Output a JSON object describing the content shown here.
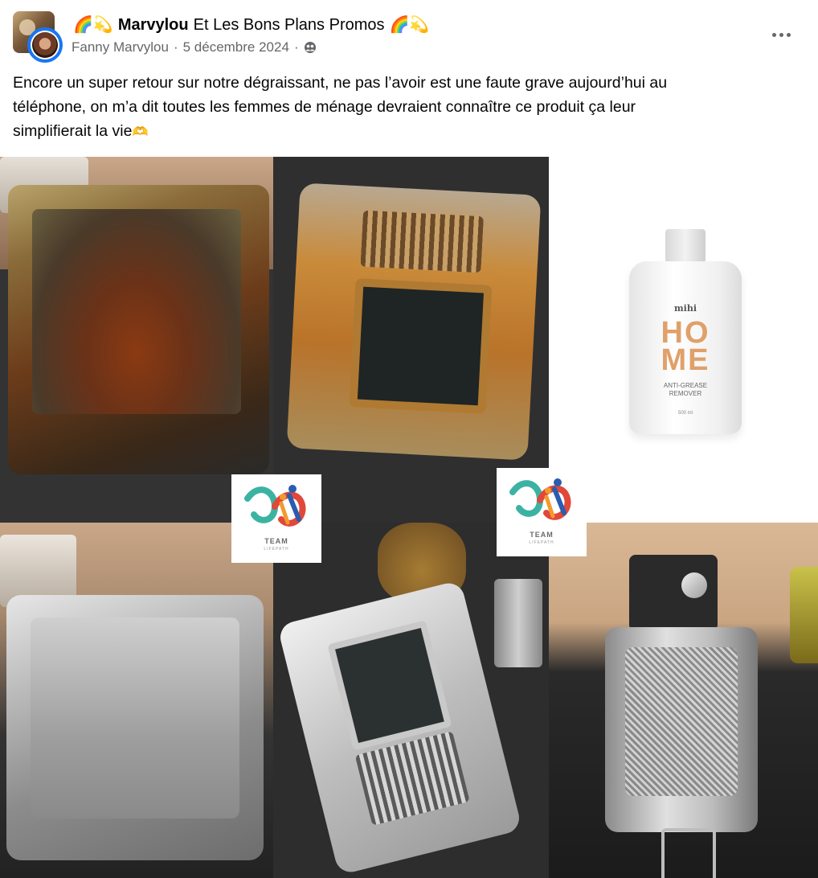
{
  "post": {
    "group": {
      "prefix_emojis": "🌈💫",
      "name_bold": "Marvylou",
      "name_rest": "Et Les Bons Plans Promos",
      "suffix_emojis": "🌈💫"
    },
    "author": "Fanny Marvylou",
    "separator": "·",
    "date": "5 décembre 2024",
    "audience_icon": "group-audience-icon",
    "more_icon": "more-options-icon",
    "text_line_1": "Encore un super retour sur notre dégraissant, ne pas l’avoir est une faute grave aujourd’hui au",
    "text_line_2": "téléphone, on m’a dit toutes les femmes de ménage devraient connaître ce produit ça leur",
    "text_line_3": "simplifierait la vie",
    "text_end_emoji": "🫶"
  },
  "product": {
    "brand": "mihi",
    "name": "HOME",
    "name_line_1": "HO",
    "name_line_2": "ME",
    "subtitle_1": "ANTI-GREASE",
    "subtitle_2": "REMOVER",
    "volume": "500 ml"
  },
  "logos": {
    "team_label": "TEAM",
    "team_sub": "LIFEPATH"
  },
  "colors": {
    "text_primary": "#050505",
    "text_secondary": "#65676b",
    "avatar_ring": "#1877f2"
  }
}
